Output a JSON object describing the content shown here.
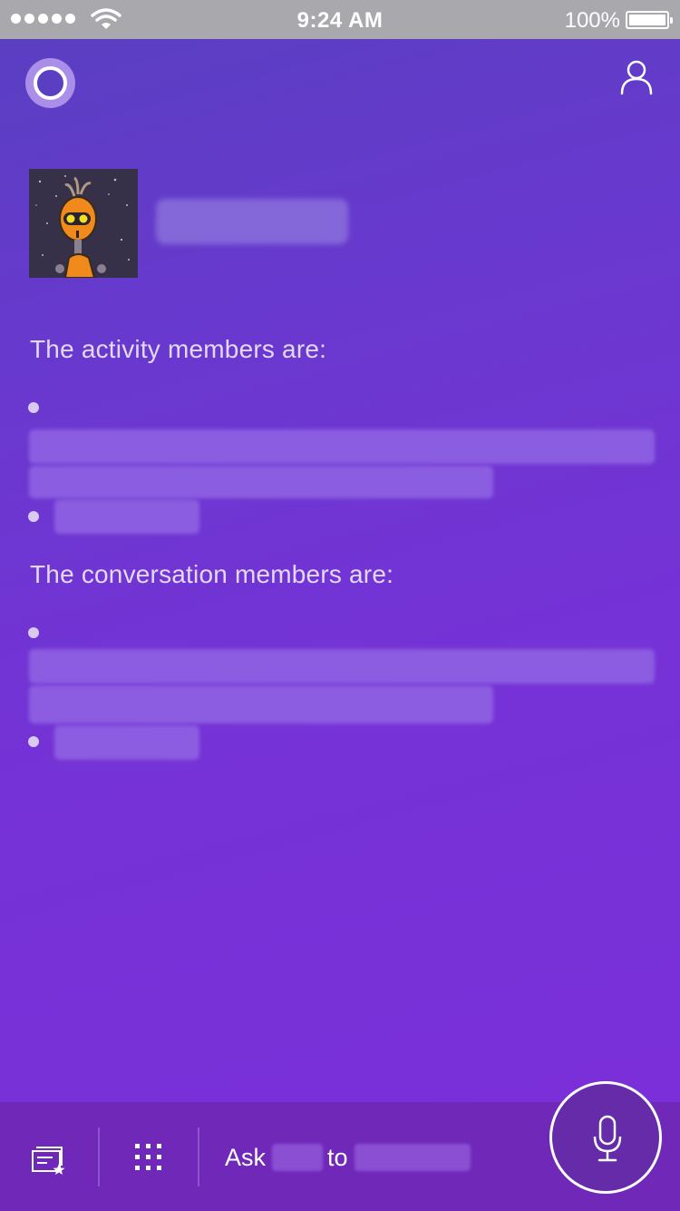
{
  "status_bar": {
    "time": "9:24 AM",
    "battery": "100%",
    "signal_icon": "cellular-signal-icon",
    "wifi_icon": "wifi-icon",
    "battery_icon": "battery-icon"
  },
  "header": {
    "left_icon": "cortana-ring-icon",
    "right_icon": "profile-person-icon"
  },
  "bot": {
    "avatar_icon": "robot-avatar-icon"
  },
  "content": {
    "activity_title": "The activity members are:",
    "conversation_title": "The conversation members are:"
  },
  "bottom_bar": {
    "notebook_icon": "notebook-star-icon",
    "apps_icon": "grid-dots-icon",
    "ask_prefix": "Ask",
    "ask_middle": "to",
    "mic_icon": "microphone-icon"
  },
  "colors": {
    "status_bar_bg": "#a9a8ad",
    "main_gradient_start": "#5a3fc2",
    "main_gradient_end": "#7a2fd8",
    "bottom_bar_bg": "#6f28b8",
    "text_light": "#e3d8f6"
  }
}
